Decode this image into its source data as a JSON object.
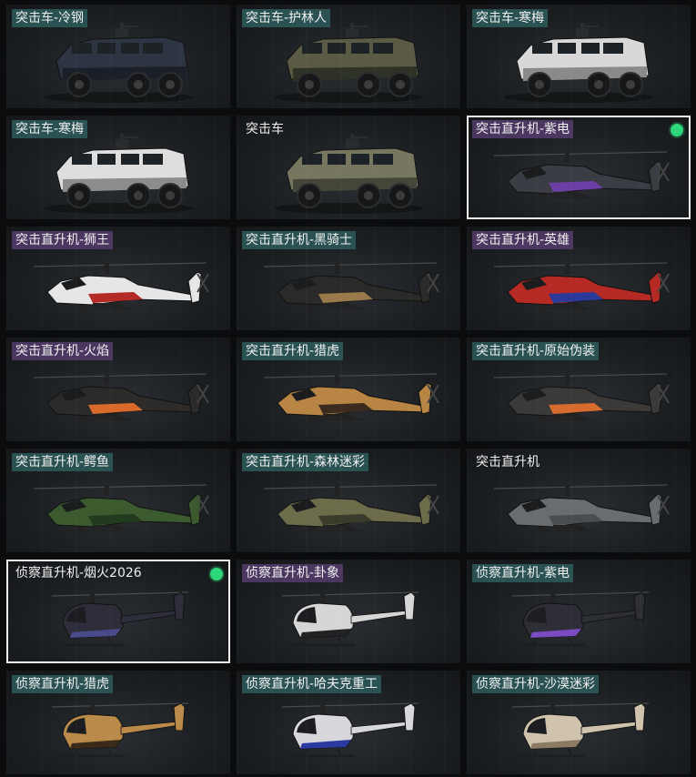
{
  "cards": [
    {
      "label": "突击车-冷钢",
      "tag": "teal",
      "type": "truck",
      "primary": "#2e3542",
      "secondary": "#1b2028",
      "selected": false,
      "equipped": false
    },
    {
      "label": "突击车-护林人",
      "tag": "teal",
      "type": "truck",
      "primary": "#5a5a45",
      "secondary": "#2f3327",
      "selected": false,
      "equipped": false
    },
    {
      "label": "突击车-寒梅",
      "tag": "teal",
      "type": "truck",
      "primary": "#d8d8d8",
      "secondary": "#8a8a8a",
      "selected": false,
      "equipped": false
    },
    {
      "label": "突击车-寒梅",
      "tag": "teal",
      "type": "truck",
      "primary": "#dedede",
      "secondary": "#8c8c8c",
      "selected": false,
      "equipped": false
    },
    {
      "label": "突击车",
      "tag": "none",
      "type": "truck",
      "primary": "#77765e",
      "secondary": "#44463a",
      "selected": false,
      "equipped": false
    },
    {
      "label": "突击直升机-紫电",
      "tag": "purple",
      "type": "heli",
      "primary": "#3b3d45",
      "secondary": "#6b3fa6",
      "selected": true,
      "equipped": true
    },
    {
      "label": "突击直升机-狮王",
      "tag": "purple",
      "type": "heli",
      "primary": "#e6e6e6",
      "secondary": "#b42a26",
      "selected": false,
      "equipped": false
    },
    {
      "label": "突击直升机-黑骑士",
      "tag": "teal",
      "type": "heli",
      "primary": "#2a2a28",
      "secondary": "#9a7a4a",
      "selected": false,
      "equipped": false
    },
    {
      "label": "突击直升机-英雄",
      "tag": "purple",
      "type": "heli",
      "primary": "#b52a25",
      "secondary": "#2b3a9a",
      "selected": false,
      "equipped": false
    },
    {
      "label": "突击直升机-火焰",
      "tag": "purple",
      "type": "heli",
      "primary": "#2c2b2a",
      "secondary": "#d96a2a",
      "selected": false,
      "equipped": false
    },
    {
      "label": "突击直升机-猎虎",
      "tag": "teal",
      "type": "heli",
      "primary": "#b88544",
      "secondary": "#3b2c1f",
      "selected": false,
      "equipped": false
    },
    {
      "label": "突击直升机-原始伪装",
      "tag": "teal",
      "type": "heli",
      "primary": "#3c3a38",
      "secondary": "#d86b2e",
      "selected": false,
      "equipped": false
    },
    {
      "label": "突击直升机-鳄鱼",
      "tag": "teal",
      "type": "heli",
      "primary": "#3b5a2e",
      "secondary": "#223a1e",
      "selected": false,
      "equipped": false
    },
    {
      "label": "突击直升机-森林迷彩",
      "tag": "teal",
      "type": "heli",
      "primary": "#6c6b4a",
      "secondary": "#3a3b2a",
      "selected": false,
      "equipped": false
    },
    {
      "label": "突击直升机",
      "tag": "none",
      "type": "heli",
      "primary": "#6a6d70",
      "secondary": "#4a4d50",
      "selected": false,
      "equipped": false
    },
    {
      "label": "侦察直升机-烟火2026",
      "tag": "none",
      "type": "scout",
      "primary": "#2d2e3a",
      "secondary": "#4a4a8a",
      "selected": true,
      "equipped": true
    },
    {
      "label": "侦察直升机-卦象",
      "tag": "purple",
      "type": "scout",
      "primary": "#d6d6d6",
      "secondary": "#222222",
      "selected": false,
      "equipped": false
    },
    {
      "label": "侦察直升机-紫电",
      "tag": "teal",
      "type": "scout",
      "primary": "#2e2f36",
      "secondary": "#7a4ac2",
      "selected": false,
      "equipped": false
    },
    {
      "label": "侦察直升机-猎虎",
      "tag": "teal",
      "type": "scout",
      "primary": "#b98a4a",
      "secondary": "#3a2a1a",
      "selected": false,
      "equipped": false
    },
    {
      "label": "侦察直升机-哈夫克重工",
      "tag": "teal",
      "type": "scout",
      "primary": "#d8d8dc",
      "secondary": "#2a3aa0",
      "selected": false,
      "equipped": false
    },
    {
      "label": "侦察直升机-沙漠迷彩",
      "tag": "teal",
      "type": "scout",
      "primary": "#cfc3ad",
      "secondary": "#8c7b63",
      "selected": false,
      "equipped": false
    }
  ]
}
